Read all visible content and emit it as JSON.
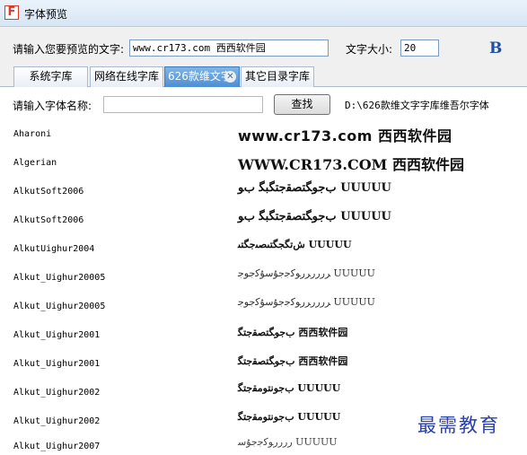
{
  "window": {
    "title": "字体预览",
    "app_icon_letter": "F"
  },
  "settings": {
    "preview_label": "请输入您要预览的文字:",
    "preview_value": "www.cr173.com 西西软件园",
    "size_label": "文字大小:",
    "size_value": "20",
    "bold_label": "B"
  },
  "tabs": [
    {
      "label": "系统字库",
      "selected": false
    },
    {
      "label": "网络在线字库",
      "selected": false
    },
    {
      "label": "626款维文字",
      "selected": true
    },
    {
      "label": "其它目录字库",
      "selected": false
    }
  ],
  "search": {
    "label": "请输入字体名称:",
    "value": "",
    "find_label": "查找",
    "path": "D:\\626款维文字字库维吾尔字体"
  },
  "fonts": [
    {
      "name": "Aharoni",
      "sample": "www.cr173.com 西西软件园"
    },
    {
      "name": "Algerian",
      "sample": "WWW.CR173.COM 西西软件园"
    },
    {
      "name": "AlkutSoft2006",
      "sample": "ﺏﺟﻮﮕﺘﺼﻘﺟﺘﮕﺒﮕ ﺏﻮ UUUUU"
    },
    {
      "name": "AlkutSoft2006",
      "sample": "ﺏﺟﻮﮕﺘﺼﻘﺟﺘﮕﺒﮕ ﺏﻮ UUUUU"
    },
    {
      "name": "AlkutUighur2004",
      "sample": "ﺵﺗﮕﺠﮕﺘﯩﺼﯩﺟﮕﺘﯩ UUUUU"
    },
    {
      "name": "Alkut_Uighur20005",
      "sample": "ﺮﺭﺭﺭﺮﺭﻮﻛﺟﺟﯘﺳﯘﻛﺟﻮﺟ UUUUU"
    },
    {
      "name": "Alkut_Uighur20005",
      "sample": "ﺮﺭﺭﺭﺮﺭﻮﻛﺟﺟﯘﺳﯘﻛﺟﻮﺟ UUUUU"
    },
    {
      "name": "Alkut_Uighur2001",
      "sample": "ﺏﺟﻮﮕﺘﺼﻘﺟﺘﮕ 西西软件园"
    },
    {
      "name": "Alkut_Uighur2001",
      "sample": "ﺏﺟﻮﮕﺘﺼﻘﺟﺘﮕ 西西软件园"
    },
    {
      "name": "Alkut_Uighur2002",
      "sample": "ﺏﺟﻮﻧﺘﻮﻣﻘﺟﺘﮕ UUUUU"
    },
    {
      "name": "Alkut_Uighur2002",
      "sample": "ﺏﺟﻮﻧﺘﻮﻣﻘﺟﺘﮕ UUUUU"
    },
    {
      "name": "Alkut_Uighur2007",
      "sample": "ﺭﺭﺭﺭﻮﻛﺟﺟﯘﺳ UUUUU"
    }
  ],
  "watermark": "最需教育"
}
